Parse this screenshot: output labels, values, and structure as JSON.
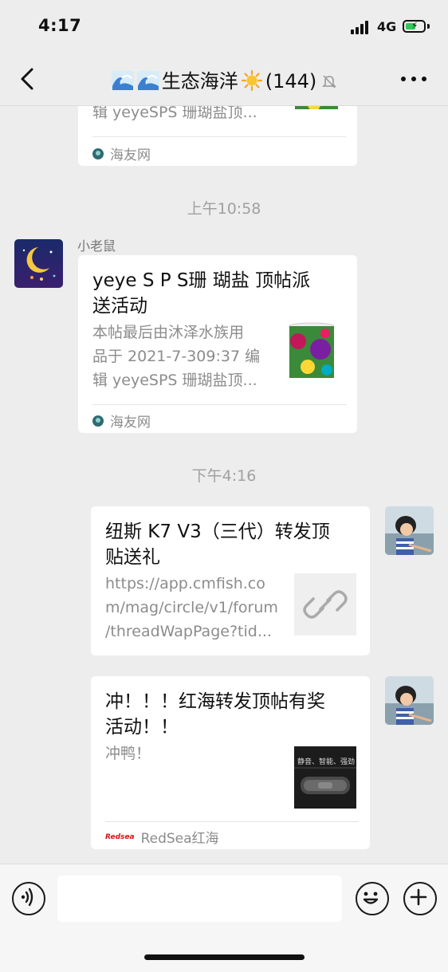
{
  "status_bar": {
    "time": "4:17",
    "network": "4G"
  },
  "header": {
    "title": "生态海洋",
    "count": "(144)"
  },
  "messages": [
    {
      "desc_lines": [
        "辑 yeyeSPS 珊瑚盐顶..."
      ],
      "source": "海友网"
    },
    {
      "timestamp": "上午10:58",
      "sender": "小老鼠",
      "title_lines": [
        "yeye S P S珊 瑚盐 顶帖派",
        "送活动"
      ],
      "desc_lines": [
        "本帖最后由沐泽水族用",
        "品于 2021-7-309:37 编",
        "辑 yeyeSPS 珊瑚盐顶..."
      ],
      "source": "海友网"
    },
    {
      "timestamp": "下午4:16",
      "title_lines": [
        "纽斯 K7 V3（三代）转发顶",
        "贴送礼"
      ],
      "desc_lines": [
        "https://app.cmfish.co",
        "m/mag/circle/v1/forum",
        "/threadWapPage?tid..."
      ]
    },
    {
      "title_lines": [
        "冲！！！红海转发顶帖有奖",
        "活动！！"
      ],
      "desc_lines": [
        "冲鸭！"
      ],
      "thumb_text": "静音、智能、强劲",
      "source_logo": "Redsea",
      "source": "RedSea红海"
    }
  ],
  "icons": {
    "back": "chevron-left-icon",
    "wave": "water-wave-icon",
    "sun": "sun-icon",
    "mute": "bell-muted-icon",
    "more": "more-icon",
    "voice": "voice-icon",
    "emoji": "emoji-icon",
    "plus": "plus-icon",
    "link": "link-icon"
  }
}
